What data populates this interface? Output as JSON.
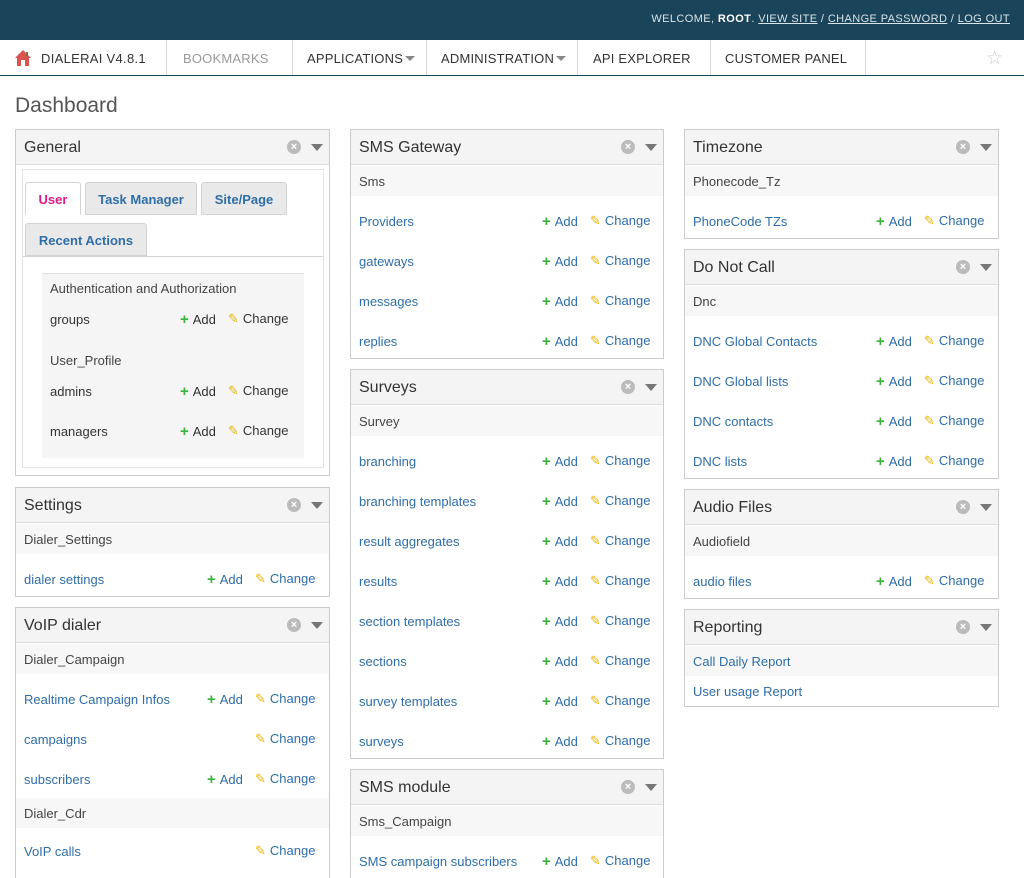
{
  "header": {
    "welcome": "WELCOME,",
    "username": "ROOT",
    "view_site": "VIEW SITE",
    "change_password": "CHANGE PASSWORD",
    "log_out": "LOG OUT"
  },
  "nav": {
    "brand": "DIALERAI V4.8.1",
    "bookmarks": "BOOKMARKS",
    "applications": "APPLICATIONS",
    "administration": "ADMINISTRATION",
    "api_explorer": "API EXPLORER",
    "customer_panel": "CUSTOMER PANEL"
  },
  "page_title": "Dashboard",
  "actions": {
    "add": "Add",
    "change": "Change"
  },
  "general": {
    "title": "General",
    "tabs": [
      "User",
      "Task Manager",
      "Site/Page",
      "Recent Actions"
    ],
    "section1": "Authentication and Authorization",
    "groups": "groups",
    "section2": "User_Profile",
    "admins": "admins",
    "managers": "managers"
  },
  "settings": {
    "title": "Settings",
    "caption": "Dialer_Settings",
    "items": [
      "dialer settings"
    ]
  },
  "voip": {
    "title": "VoIP dialer",
    "caption1": "Dialer_Campaign",
    "items1": [
      "Realtime Campaign Infos",
      "campaigns",
      "subscribers"
    ],
    "caption2": "Dialer_Cdr",
    "items2": [
      "VoIP calls"
    ]
  },
  "sms_gateway": {
    "title": "SMS Gateway",
    "caption": "Sms",
    "items": [
      "Providers",
      "gateways",
      "messages",
      "replies"
    ]
  },
  "surveys": {
    "title": "Surveys",
    "caption": "Survey",
    "items": [
      "branching",
      "branching templates",
      "result aggregates",
      "results",
      "section templates",
      "sections",
      "survey templates",
      "surveys"
    ]
  },
  "sms_module": {
    "title": "SMS module",
    "caption": "Sms_Campaign",
    "items": [
      "SMS campaign subscribers"
    ]
  },
  "timezone": {
    "title": "Timezone",
    "caption": "Phonecode_Tz",
    "items": [
      "PhoneCode TZs"
    ]
  },
  "dnc": {
    "title": "Do Not Call",
    "caption": "Dnc",
    "items": [
      "DNC Global Contacts",
      "DNC Global lists",
      "DNC contacts",
      "DNC lists"
    ]
  },
  "audio": {
    "title": "Audio Files",
    "caption": "Audiofield",
    "items": [
      "audio files"
    ]
  },
  "reporting": {
    "title": "Reporting",
    "items": [
      "Call Daily Report",
      "User usage Report"
    ]
  },
  "colors": {
    "topbar": "#1a4459",
    "link": "#2f6ea8",
    "active_tab": "#e0198a",
    "add_icon": "#3ab13a",
    "change_icon": "#e8b400"
  },
  "icons": [
    "home-icon",
    "caret-down-icon",
    "star-icon",
    "close-circle-icon",
    "collapse-icon",
    "plus-icon",
    "pencil-icon"
  ]
}
